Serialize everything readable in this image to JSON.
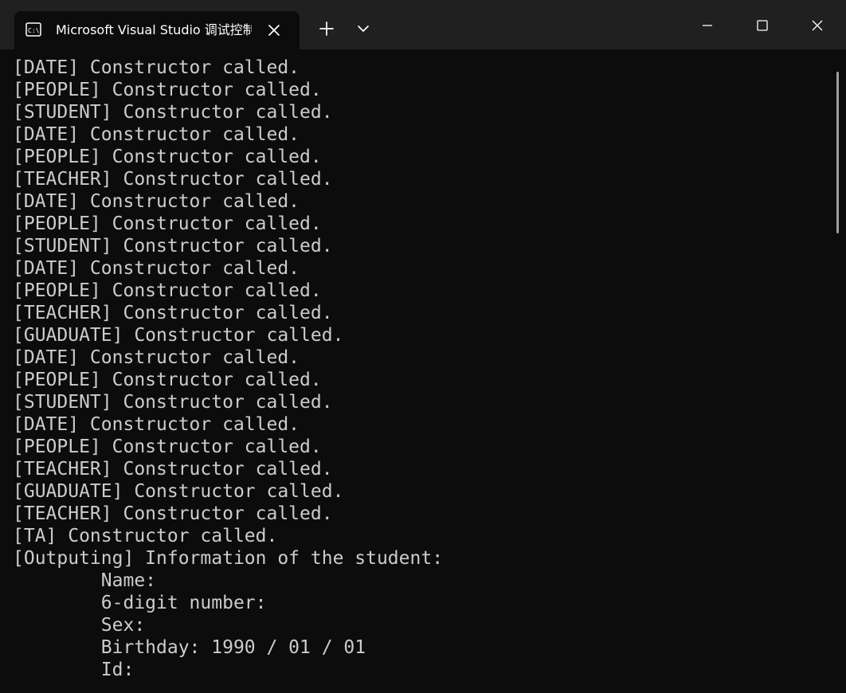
{
  "window": {
    "tab_title": "Microsoft Visual Studio 调试控制台"
  },
  "icons": {
    "tab": "console-icon",
    "close_tab": "close-icon",
    "new_tab": "plus-icon",
    "dropdown": "chevron-down-icon",
    "minimize": "minimize-icon",
    "maximize": "maximize-icon",
    "close_window": "close-icon"
  },
  "console": {
    "lines": [
      "[DATE] Constructor called.",
      "[PEOPLE] Constructor called.",
      "[STUDENT] Constructor called.",
      "[DATE] Constructor called.",
      "[PEOPLE] Constructor called.",
      "[TEACHER] Constructor called.",
      "[DATE] Constructor called.",
      "[PEOPLE] Constructor called.",
      "[STUDENT] Constructor called.",
      "[DATE] Constructor called.",
      "[PEOPLE] Constructor called.",
      "[TEACHER] Constructor called.",
      "[GUADUATE] Constructor called.",
      "[DATE] Constructor called.",
      "[PEOPLE] Constructor called.",
      "[STUDENT] Constructor called.",
      "[DATE] Constructor called.",
      "[PEOPLE] Constructor called.",
      "[TEACHER] Constructor called.",
      "[GUADUATE] Constructor called.",
      "[TEACHER] Constructor called.",
      "[TA] Constructor called.",
      "[Outputing] Information of the student:",
      "        Name:",
      "        6-digit number:",
      "        Sex:",
      "        Birthday: 1990 / 01 / 01",
      "        Id:"
    ]
  },
  "colors": {
    "console_background": "#0c0c0c",
    "titlebar_background": "#202020",
    "console_text": "#cccccc"
  }
}
